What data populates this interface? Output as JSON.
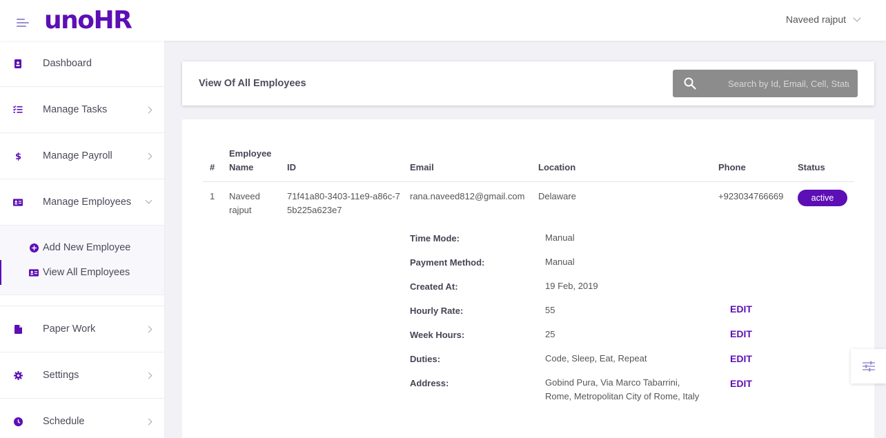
{
  "app": {
    "logo": "unoHR"
  },
  "header": {
    "user_name": "Naveed rajput"
  },
  "sidebar": {
    "items": [
      {
        "label": "Dashboard",
        "icon": "address-book-icon"
      },
      {
        "label": "Manage Tasks",
        "icon": "tasks-list-icon"
      },
      {
        "label": "Manage Payroll",
        "icon": "dollar-icon"
      },
      {
        "label": "Manage Employees",
        "icon": "id-card-icon"
      },
      {
        "label": "Paper Work",
        "icon": "file-icon"
      },
      {
        "label": "Settings",
        "icon": "gear-icon"
      },
      {
        "label": "Schedule",
        "icon": "clock-icon"
      }
    ],
    "sub_items": [
      {
        "label": "Add New Employee",
        "icon": "plus-circle-icon"
      },
      {
        "label": "View All Employees",
        "icon": "id-card-icon"
      }
    ]
  },
  "page": {
    "title": "View Of All Employees",
    "search_placeholder": "Search by Id, Email, Cell, Status"
  },
  "table": {
    "columns": [
      "#",
      "Employee Name",
      "ID",
      "Email",
      "Location",
      "Phone",
      "Status"
    ],
    "rows": [
      {
        "index": "1",
        "name": "Naveed rajput",
        "id": "71f41a80-3403-11e9-a86c-75b225a623e7",
        "email": "rana.naveed812@gmail.com",
        "location": "Delaware",
        "phone": "+923034766669",
        "status": "active"
      }
    ]
  },
  "details": {
    "fields": [
      {
        "label": "Time Mode:",
        "value": "Manual"
      },
      {
        "label": "Payment Method:",
        "value": "Manual"
      },
      {
        "label": "Created At:",
        "value": "19 Feb, 2019"
      },
      {
        "label": "Hourly Rate:",
        "value": "55",
        "action": "EDIT"
      },
      {
        "label": "Week Hours:",
        "value": "25",
        "action": "EDIT"
      },
      {
        "label": "Duties:",
        "value": "Code, Sleep, Eat, Repeat",
        "action": "EDIT"
      },
      {
        "label": "Address:",
        "value": "Gobind Pura, Via Marco Tabarrini, Rome, Metropolitan City of Rome, Italy",
        "action": "EDIT"
      }
    ]
  },
  "colors": {
    "brand": "#5c0fb5",
    "search_bg": "#8c8c8c"
  }
}
